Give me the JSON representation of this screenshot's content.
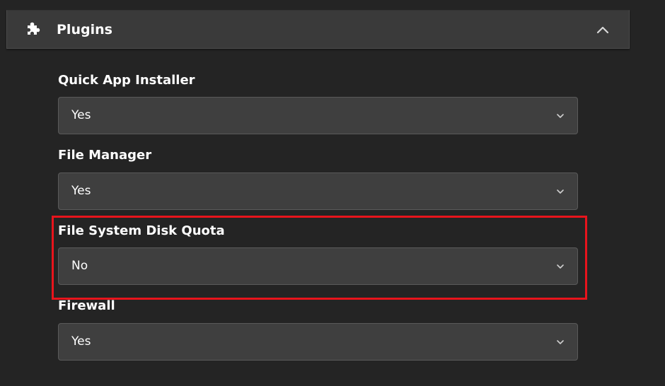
{
  "section": {
    "title": "Plugins",
    "icon": "puzzle-icon",
    "collapse_icon": "chevron-up-icon"
  },
  "fields": [
    {
      "label": "Quick App Installer",
      "value": "Yes"
    },
    {
      "label": "File Manager",
      "value": "Yes"
    },
    {
      "label": "File System Disk Quota",
      "value": "No"
    },
    {
      "label": "Firewall",
      "value": "Yes"
    }
  ],
  "highlight": {
    "target": "File System Disk Quota",
    "color": "#e8141c"
  },
  "colors": {
    "background": "#242424",
    "header": "#3a3a3a",
    "select": "#3f3f3f",
    "text": "#ffffff"
  }
}
